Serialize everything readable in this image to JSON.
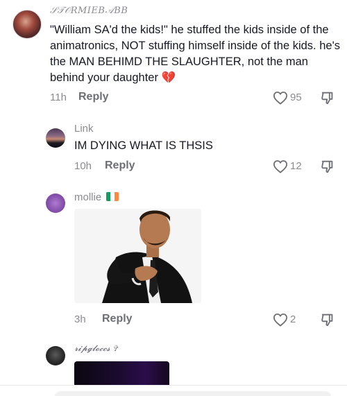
{
  "comments": [
    {
      "username": "𝒮𝒯𝒪𝑅𝑀𝐼𝐸𝐵𝒜𝐵𝐵",
      "text": "\"William SA'd the kids!\" he stuffed the kids inside of the animatronics, NOT stuffing himself inside of the kids. he's the MAN BEHIMD THE SLAUGHTER, not the man behind your daughter 💔",
      "time": "11h",
      "reply_label": "Reply",
      "likes": "95"
    },
    {
      "username": "Link",
      "text": "IM DYING WHAT IS THSIS",
      "time": "10h",
      "reply_label": "Reply",
      "likes": "12"
    },
    {
      "username": "mollie",
      "flag_colors": [
        "#169b62",
        "#ffffff",
        "#ff883e"
      ],
      "media": "photo of a man in a black leather jacket and white shirt extending his hand",
      "time": "3h",
      "reply_label": "Reply",
      "likes": "2"
    },
    {
      "username": "𝓻𝓲𝓹𝓰𝓵𝓸𝓬𝓬𝓼 ✞",
      "media": "dark purple image"
    }
  ],
  "icons": {
    "like": "heart-outline-icon",
    "dislike": "thumbs-down-icon"
  },
  "colors": {
    "text": "#161823",
    "muted": "#8a8b91",
    "reply": "#6e6f75"
  }
}
